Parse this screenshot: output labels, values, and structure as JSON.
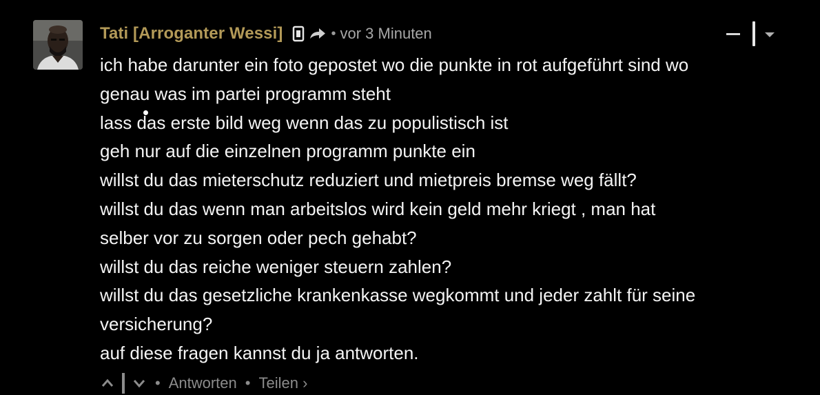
{
  "comment": {
    "author": "Tati [Arroganter Wessi]",
    "separator": "•",
    "timestamp": "vor 3 Minuten",
    "body_lines": [
      "ich habe darunter ein foto gepostet wo die punkte in rot aufgeführt sind wo",
      "genau was im partei programm steht",
      "lass das erste bild weg wenn das zu populistisch ist",
      "geh nur auf die einzelnen programm punkte ein",
      "willst du das mieterschutz reduziert und mietpreis bremse weg fällt?",
      "willst du das wenn man arbeitslos wird kein geld mehr kriegt , man hat",
      "selber vor zu sorgen oder pech gehabt?",
      "willst du das reiche weniger steuern zahlen?",
      "willst du das gesetzliche krankenkasse wegkommt und jeder zahlt für seine",
      "versicherung?",
      "auf diese fragen kannst du ja antworten."
    ],
    "icons": {
      "badge": "badge-icon",
      "reply": "reply-arrow-icon",
      "collapse": "collapse-icon",
      "menu": "menu-caret-icon",
      "upvote": "upvote-icon",
      "downvote": "downvote-icon"
    }
  },
  "footer": {
    "separator": "•",
    "reply_label": "Antworten",
    "share_label": "Teilen ›"
  },
  "colors": {
    "background": "#000000",
    "author": "#b39a58",
    "text": "#f4f4f4",
    "muted": "#a8a8a8"
  }
}
